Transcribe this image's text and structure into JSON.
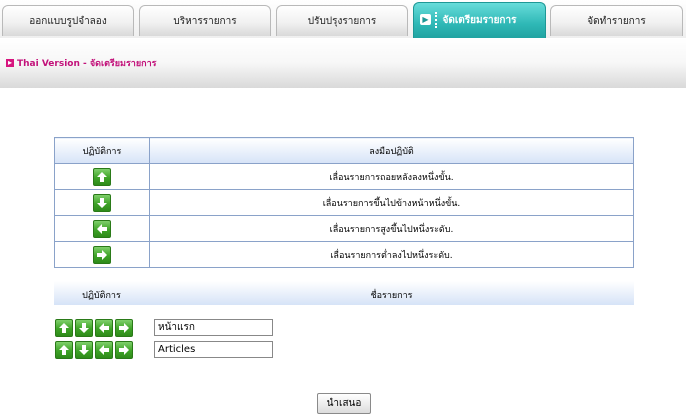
{
  "tabs": [
    {
      "label": "ออกแบบรูปจำลอง"
    },
    {
      "label": "บริหารรายการ"
    },
    {
      "label": "ปรับปรุงรายการ"
    },
    {
      "label": "จัดเตรียมรายการ"
    },
    {
      "label": "จัดทำรายการ"
    }
  ],
  "breadcrumb": {
    "text": "Thai Version - จัดเตรียมรายการ"
  },
  "legend": {
    "header_action": "ปฏิบัติการ",
    "header_desc": "ลงมือปฏิบัติ",
    "rows": [
      {
        "icon": "arrow-up-icon",
        "desc": "เลื่อนรายการถอยหลังลงหนึ่งขั้น."
      },
      {
        "icon": "arrow-down-icon",
        "desc": "เลื่อนรายการขึ้นไปข้างหน้าหนึ่งขั้น."
      },
      {
        "icon": "arrow-left-icon",
        "desc": "เลื่อนรายการสูงขึ้นไปหนึ่งระดับ."
      },
      {
        "icon": "arrow-right-icon",
        "desc": "เลื่อนรายการต่ำลงไปหนึ่งระดับ."
      }
    ]
  },
  "list": {
    "header_action": "ปฏิบัติการ",
    "header_name": "ชื่อรายการ",
    "items": [
      {
        "name": "หน้าแรก"
      },
      {
        "name": "Articles"
      }
    ]
  },
  "submit_label": "นำเสนอ",
  "colors": {
    "active_tab": "#2fb8b6",
    "breadcrumb": "#c2127a",
    "button_green": "#3ea327",
    "table_border": "#8aa2c9"
  }
}
